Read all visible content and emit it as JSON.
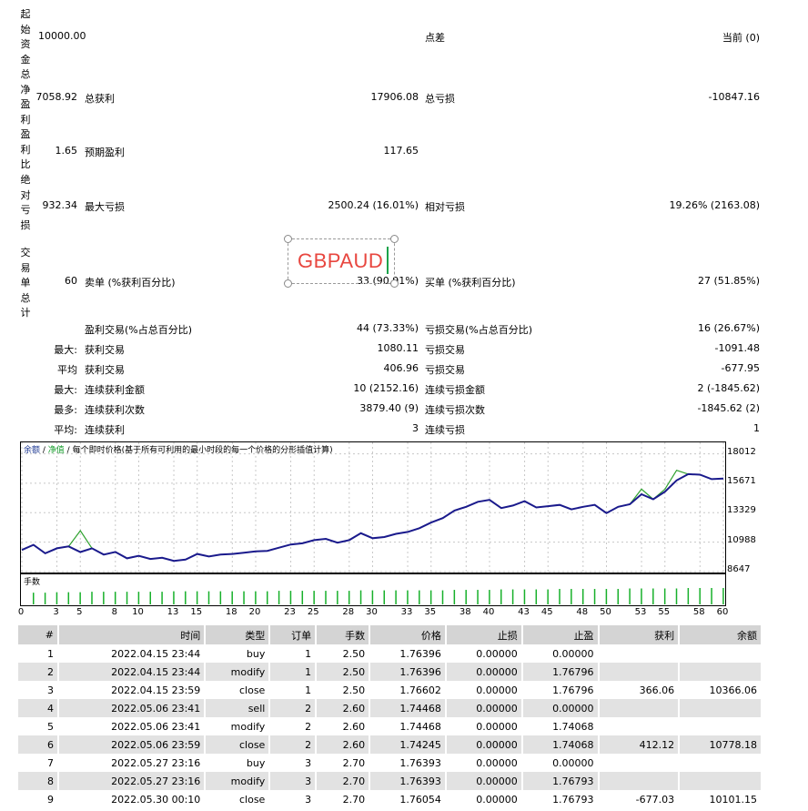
{
  "stats": {
    "start_capital_label": "起始资金",
    "start_capital_value": "10000.00",
    "spread_label": "点差",
    "spread_value": "当前 (0)",
    "net_profit_label": "总净盈利",
    "net_profit_value": "7058.92",
    "gross_profit_label": "总获利",
    "gross_profit_value": "17906.08",
    "gross_loss_label": "总亏损",
    "gross_loss_value": "-10847.16",
    "profit_factor_label": "盈利比",
    "profit_factor_value": "1.65",
    "expected_payoff_label": "预期盈利",
    "expected_payoff_value": "117.65",
    "abs_dd_label": "绝对亏损",
    "abs_dd_value": "932.34",
    "max_dd_label": "最大亏损",
    "max_dd_value": "2500.24 (16.01%)",
    "rel_dd_label": "相对亏损",
    "rel_dd_value": "19.26% (2163.08)",
    "total_trades_label": "交易单总计",
    "total_trades_value": "60",
    "short_label": "卖单 (%获利百分比)",
    "short_value": "33 (90.91%)",
    "long_label": "买单 (%获利百分比)",
    "long_value": "27 (51.85%)",
    "win_label": "盈利交易(%占总百分比)",
    "win_value": "44 (73.33%)",
    "loss_label": "亏损交易(%占总百分比)",
    "loss_value": "16 (26.67%)",
    "largest_prefix": "最大:",
    "largest_win_label": "获利交易",
    "largest_win_value": "1080.11",
    "largest_loss_label": "亏损交易",
    "largest_loss_value": "-1091.48",
    "avg_prefix": "平均",
    "avg_win_label": "获利交易",
    "avg_win_value": "406.96",
    "avg_loss_label": "亏损交易",
    "avg_loss_value": "-677.95",
    "max_prefix": "最大:",
    "max_consec_win_label": "连续获利金额",
    "max_consec_win_value": "10 (2152.16)",
    "max_consec_loss_label": "连续亏损金额",
    "max_consec_loss_value": "2 (-1845.62)",
    "most_prefix": "最多:",
    "most_consec_win_label": "连续获利次数",
    "most_consec_win_value": "3879.40 (9)",
    "most_consec_loss_label": "连续亏损次数",
    "most_consec_loss_value": "-1845.62 (2)",
    "avg2_prefix": "平均:",
    "avg_consec_win_label": "连续获利",
    "avg_consec_win_value": "3",
    "avg_consec_loss_label": "连续亏损",
    "avg_consec_loss_value": "1"
  },
  "overlay": {
    "text": "GBPAUD"
  },
  "chart_header": {
    "balance": "余额",
    "sep1": " / ",
    "equity": "净值",
    "sep2": " / ",
    "model": "每个即时价格(基于所有可利用的最小时段的每一个价格的分形插值计算)"
  },
  "volume_label": "手数",
  "chart_data": {
    "type": "line",
    "x": [
      0,
      1,
      2,
      3,
      4,
      5,
      6,
      7,
      8,
      9,
      10,
      11,
      12,
      13,
      14,
      15,
      16,
      17,
      18,
      19,
      20,
      21,
      22,
      23,
      24,
      25,
      26,
      27,
      28,
      29,
      30,
      31,
      32,
      33,
      34,
      35,
      36,
      37,
      38,
      39,
      40,
      41,
      42,
      43,
      44,
      45,
      46,
      47,
      48,
      49,
      50,
      51,
      52,
      53,
      54,
      55,
      56,
      57,
      58,
      59,
      60
    ],
    "x_tick_labels": [
      "0",
      "3",
      "5",
      "8",
      "10",
      "13",
      "15",
      "18",
      "20",
      "23",
      "25",
      "28",
      "30",
      "33",
      "35",
      "38",
      "40",
      "43",
      "45",
      "48",
      "50",
      "53",
      "55",
      "58",
      "60"
    ],
    "x_tick_positions": [
      0,
      3,
      5,
      8,
      10,
      13,
      15,
      18,
      20,
      23,
      25,
      28,
      30,
      33,
      35,
      38,
      40,
      43,
      45,
      48,
      50,
      53,
      55,
      58,
      60
    ],
    "y_ticks": [
      18012,
      15671,
      13329,
      10988,
      8647
    ],
    "ylim": [
      8647,
      18850
    ],
    "series": [
      {
        "name": "余额",
        "color": "#1a1a8c",
        "values": [
          10366,
          10778,
          10101,
          10500,
          10650,
          10200,
          10500,
          10000,
          10210,
          9700,
          9900,
          9650,
          9750,
          9500,
          9600,
          10050,
          9850,
          10000,
          10050,
          10150,
          10250,
          10300,
          10550,
          10800,
          10900,
          11150,
          11250,
          10950,
          11150,
          11700,
          11300,
          11400,
          11650,
          11800,
          12100,
          12550,
          12900,
          13500,
          13800,
          14200,
          14350,
          13700,
          13900,
          14250,
          13750,
          13850,
          13950,
          13600,
          13800,
          13950,
          13300,
          13800,
          14000,
          14800,
          14400,
          15000,
          15900,
          16400,
          16350,
          16000,
          16050
        ]
      },
      {
        "name": "净值",
        "color": "#2ca02c",
        "values": [
          10366,
          10778,
          10101,
          10500,
          10650,
          11900,
          10500,
          10000,
          10210,
          9700,
          9900,
          9650,
          9750,
          9500,
          9600,
          10050,
          9850,
          10000,
          10050,
          10150,
          10250,
          10300,
          10550,
          10800,
          10900,
          11150,
          11250,
          10950,
          11150,
          11700,
          11300,
          11400,
          11650,
          11800,
          12100,
          12550,
          12900,
          13500,
          13800,
          14200,
          14350,
          13700,
          13900,
          14250,
          13750,
          13850,
          13950,
          13600,
          13800,
          13950,
          13300,
          13800,
          14000,
          15200,
          14400,
          15200,
          16700,
          16400,
          16350,
          16000,
          16050
        ]
      }
    ],
    "volume": [
      2.5,
      2.5,
      2.6,
      2.6,
      2.6,
      2.7,
      2.7,
      2.7,
      2.7,
      2.7,
      2.7,
      2.7,
      2.8,
      2.8,
      2.8,
      2.8,
      2.8,
      2.8,
      2.8,
      2.8,
      2.8,
      2.9,
      2.9,
      2.9,
      2.9,
      2.9,
      2.9,
      2.9,
      3.0,
      3.0,
      3.0,
      3.0,
      3.0,
      3.0,
      3.0,
      3.0,
      3.1,
      3.1,
      3.1,
      3.1,
      3.2,
      3.2,
      3.2,
      3.2,
      3.2,
      3.3,
      3.3,
      3.3,
      3.3,
      3.3,
      3.3,
      3.4,
      3.4,
      3.4,
      3.4,
      3.4,
      3.5,
      3.5,
      3.5,
      3.5,
      3.5
    ]
  },
  "table": {
    "headers": [
      "#",
      "时间",
      "类型",
      "订单",
      "手数",
      "价格",
      "止损",
      "止盈",
      "获利",
      "余额"
    ],
    "rows": [
      [
        "1",
        "2022.04.15 23:44",
        "buy",
        "1",
        "2.50",
        "1.76396",
        "0.00000",
        "0.00000",
        "",
        ""
      ],
      [
        "2",
        "2022.04.15 23:44",
        "modify",
        "1",
        "2.50",
        "1.76396",
        "0.00000",
        "1.76796",
        "",
        ""
      ],
      [
        "3",
        "2022.04.15 23:59",
        "close",
        "1",
        "2.50",
        "1.76602",
        "0.00000",
        "1.76796",
        "366.06",
        "10366.06"
      ],
      [
        "4",
        "2022.05.06 23:41",
        "sell",
        "2",
        "2.60",
        "1.74468",
        "0.00000",
        "0.00000",
        "",
        ""
      ],
      [
        "5",
        "2022.05.06 23:41",
        "modify",
        "2",
        "2.60",
        "1.74468",
        "0.00000",
        "1.74068",
        "",
        ""
      ],
      [
        "6",
        "2022.05.06 23:59",
        "close",
        "2",
        "2.60",
        "1.74245",
        "0.00000",
        "1.74068",
        "412.12",
        "10778.18"
      ],
      [
        "7",
        "2022.05.27 23:16",
        "buy",
        "3",
        "2.70",
        "1.76393",
        "0.00000",
        "0.00000",
        "",
        ""
      ],
      [
        "8",
        "2022.05.27 23:16",
        "modify",
        "3",
        "2.70",
        "1.76393",
        "0.00000",
        "1.76793",
        "",
        ""
      ],
      [
        "9",
        "2022.05.30 00:10",
        "close",
        "3",
        "2.70",
        "1.76054",
        "0.00000",
        "1.76793",
        "-677.03",
        "10101.15"
      ]
    ]
  }
}
